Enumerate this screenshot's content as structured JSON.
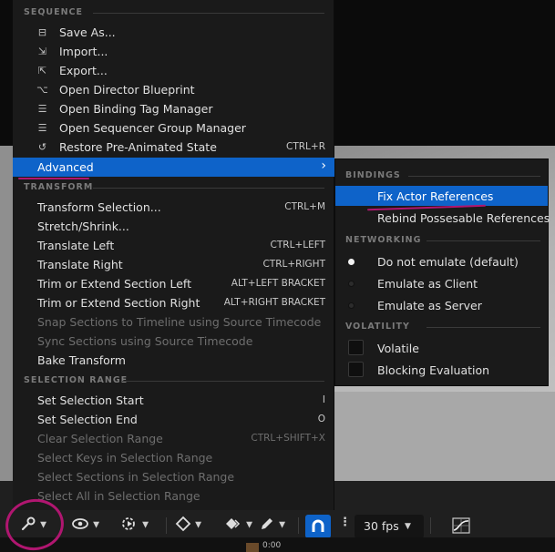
{
  "main_menu": {
    "sequence_header": "SEQUENCE",
    "sequence_items": [
      {
        "label": "Save As...",
        "icon": "save-as-icon",
        "glyph": "⊟"
      },
      {
        "label": "Import...",
        "icon": "import-icon",
        "glyph": "⇲"
      },
      {
        "label": "Export...",
        "icon": "export-icon",
        "glyph": "⇱"
      },
      {
        "label": "Open Director Blueprint",
        "icon": "director-blueprint-icon",
        "glyph": "⌥"
      },
      {
        "label": "Open Binding Tag Manager",
        "icon": "tag-manager-icon",
        "glyph": "☰"
      },
      {
        "label": "Open Sequencer Group Manager",
        "icon": "group-manager-icon",
        "glyph": "☰"
      },
      {
        "label": "Restore Pre-Animated State",
        "icon": "restore-icon",
        "glyph": "↺",
        "shortcut": "CTRL+R"
      }
    ],
    "advanced_label": "Advanced",
    "transform_header": "TRANSFORM",
    "transform_items": [
      {
        "label": "Transform Selection...",
        "shortcut": "CTRL+M",
        "enabled": true
      },
      {
        "label": "Stretch/Shrink...",
        "shortcut": "",
        "enabled": true
      },
      {
        "label": "Translate Left",
        "shortcut": "CTRL+LEFT",
        "enabled": true
      },
      {
        "label": "Translate Right",
        "shortcut": "CTRL+RIGHT",
        "enabled": true
      },
      {
        "label": "Trim or Extend Section Left",
        "shortcut": "ALT+LEFT BRACKET",
        "enabled": true
      },
      {
        "label": "Trim or Extend Section Right",
        "shortcut": "ALT+RIGHT BRACKET",
        "enabled": true
      },
      {
        "label": "Snap Sections to Timeline using Source Timecode",
        "shortcut": "",
        "enabled": false
      },
      {
        "label": "Sync Sections using Source Timecode",
        "shortcut": "",
        "enabled": false
      },
      {
        "label": "Bake Transform",
        "shortcut": "",
        "enabled": true
      }
    ],
    "selection_header": "SELECTION RANGE",
    "selection_items": [
      {
        "label": "Set Selection Start",
        "shortcut": "I",
        "enabled": true
      },
      {
        "label": "Set Selection End",
        "shortcut": "O",
        "enabled": true
      },
      {
        "label": "Clear Selection Range",
        "shortcut": "CTRL+SHIFT+X",
        "enabled": false
      },
      {
        "label": "Select Keys in Selection Range",
        "shortcut": "",
        "enabled": false
      },
      {
        "label": "Select Sections in Selection Range",
        "shortcut": "",
        "enabled": false
      },
      {
        "label": "Select All in Selection Range",
        "shortcut": "",
        "enabled": false
      }
    ]
  },
  "sub_menu": {
    "bindings_header": "BINDINGS",
    "fix_actor": "Fix Actor References",
    "rebind": "Rebind Possesable References",
    "networking_header": "NETWORKING",
    "networking_options": [
      {
        "label": "Do not emulate (default)",
        "selected": true
      },
      {
        "label": "Emulate as Client",
        "selected": false
      },
      {
        "label": "Emulate as Server",
        "selected": false
      }
    ],
    "volatility_header": "VOLATILITY",
    "volatility_options": [
      {
        "label": "Volatile",
        "checked": false
      },
      {
        "label": "Blocking Evaluation",
        "checked": false
      }
    ]
  },
  "toolbar": {
    "fps_label": "30 fps",
    "bottom_readout": "0:00"
  },
  "colors": {
    "accent": "#0e63c9",
    "annotation": "#b01670",
    "menu_bg": "#1a1a1a"
  }
}
